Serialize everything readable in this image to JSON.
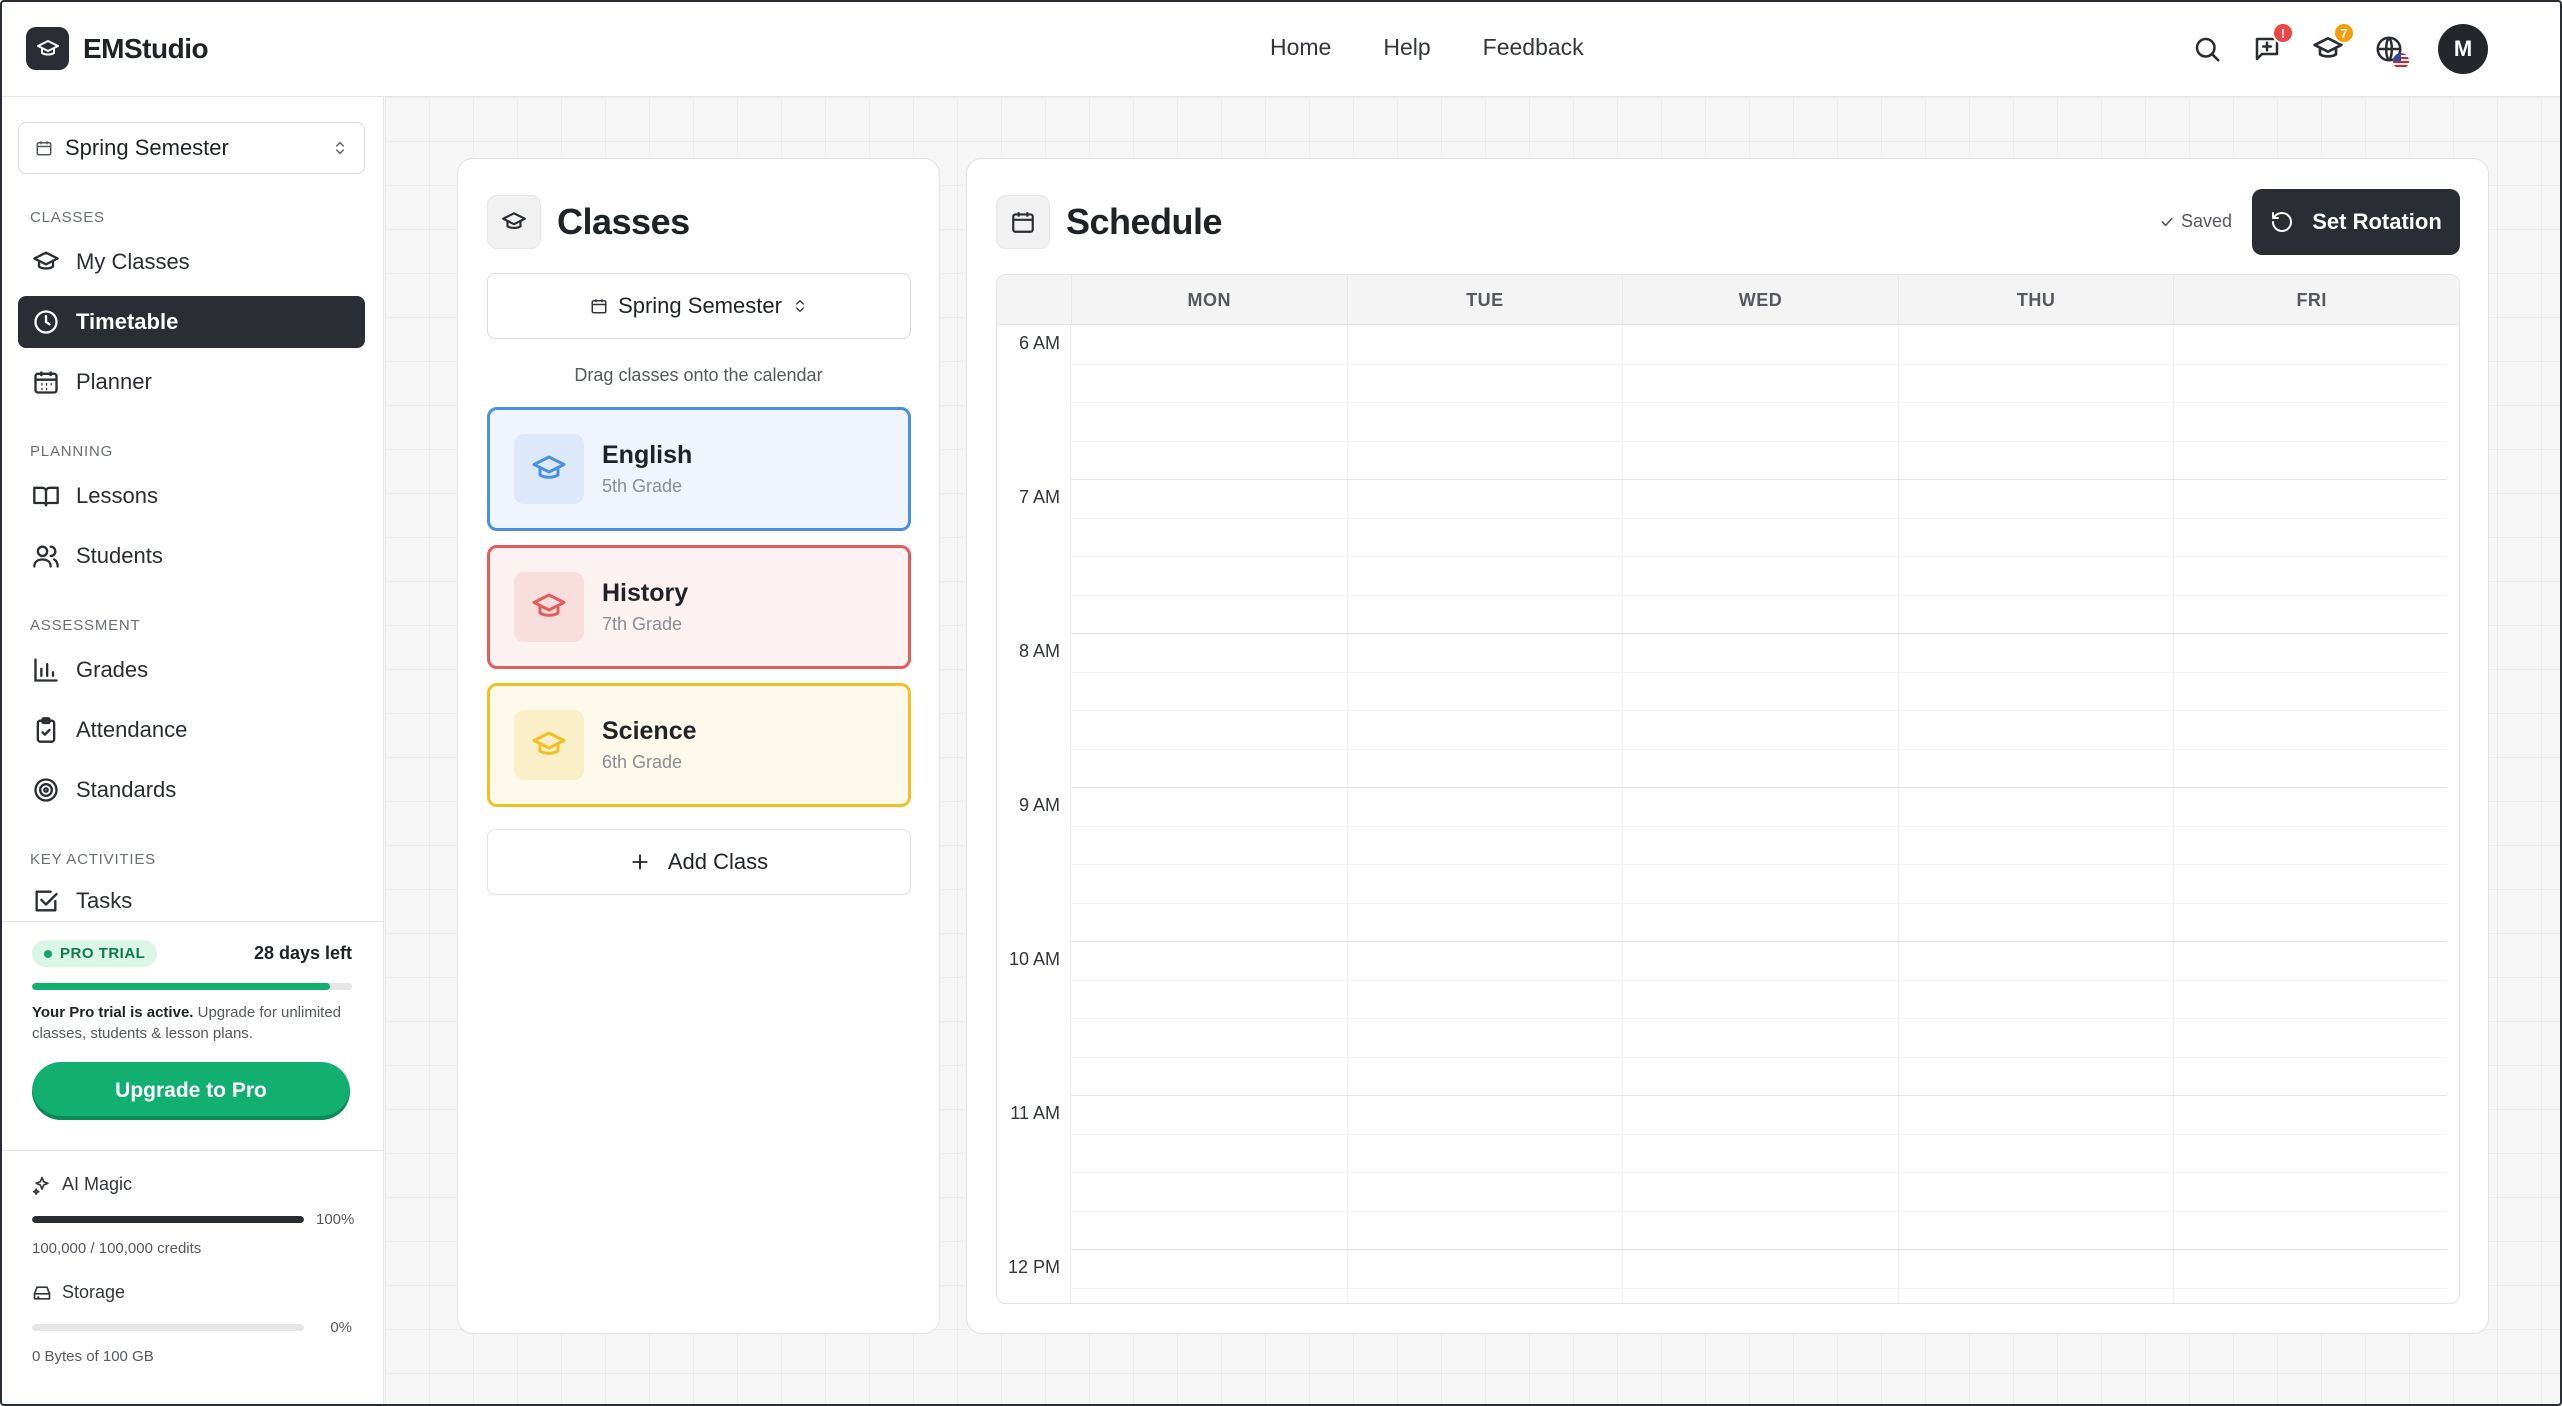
{
  "app": {
    "name": "EMStudio"
  },
  "topnav": {
    "items": [
      "Home",
      "Help",
      "Feedback"
    ]
  },
  "topbar": {
    "messages_badge": "!",
    "classes_badge": "7",
    "avatar_initial": "M"
  },
  "sidebar": {
    "semester": "Spring Semester",
    "sections": {
      "classes": "CLASSES",
      "planning": "PLANNING",
      "assessment": "ASSESSMENT",
      "key_activities": "KEY ACTIVITIES"
    },
    "items": {
      "my_classes": "My Classes",
      "timetable": "Timetable",
      "planner": "Planner",
      "lessons": "Lessons",
      "students": "Students",
      "grades": "Grades",
      "attendance": "Attendance",
      "standards": "Standards",
      "tasks": "Tasks"
    },
    "active_item": "Timetable",
    "trial": {
      "badge": "PRO TRIAL",
      "days_left": "28 days left",
      "progress": 0.93,
      "text_bold": "Your Pro trial is active.",
      "text": " Upgrade for unlimited classes, students & lesson plans.",
      "upgrade_label": "Upgrade to Pro"
    },
    "ai_magic": {
      "label": "AI Magic",
      "percent": "100%",
      "fraction": 1.0,
      "detail": "100,000 / 100,000 credits"
    },
    "storage": {
      "label": "Storage",
      "percent": "0%",
      "fraction": 0.0,
      "detail": "0 Bytes of 100 GB"
    }
  },
  "classes_panel": {
    "title": "Classes",
    "semester": "Spring Semester",
    "hint": "Drag classes onto the calendar",
    "classes": [
      {
        "name": "English",
        "grade": "5th Grade",
        "color": "#4a90e2",
        "bg": "#f0f5fd",
        "icon_bg": "#dde9fa"
      },
      {
        "name": "History",
        "grade": "7th Grade",
        "color": "#e35d5d",
        "bg": "#fdf2f2",
        "icon_bg": "#f9dede"
      },
      {
        "name": "Science",
        "grade": "6th Grade",
        "color": "#f0c024",
        "bg": "#fefaeb",
        "icon_bg": "#fbefc8"
      }
    ],
    "add_label": "Add Class"
  },
  "schedule": {
    "title": "Schedule",
    "saved_label": "Saved",
    "rotation_label": "Set Rotation",
    "days": [
      "MON",
      "TUE",
      "WED",
      "THU",
      "FRI"
    ],
    "times": [
      "6 AM",
      "7 AM",
      "8 AM",
      "9 AM",
      "10 AM",
      "11 AM",
      "12 PM"
    ]
  }
}
